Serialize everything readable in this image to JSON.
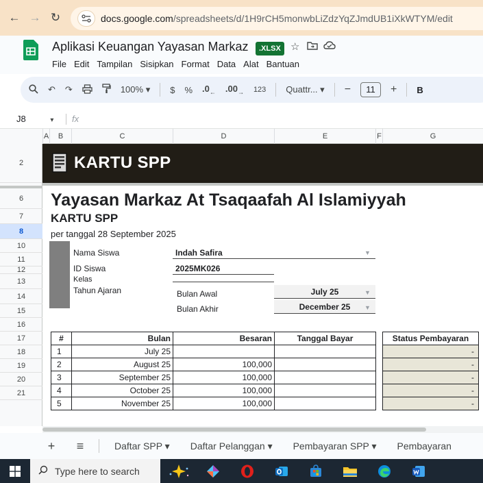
{
  "browser": {
    "back_icon": "arrow-left-icon",
    "forward_icon": "arrow-right-icon",
    "reload_icon": "reload-icon",
    "url_domain": "docs.google.com",
    "url_path": "/spreadsheets/d/1H9rCH5monwbLiZdzYqZJmdUB1iXkWTYM/edit"
  },
  "app": {
    "title": "Aplikasi Keuangan Yayasan Markaz",
    "badge": ".XLSX",
    "menu": [
      "File",
      "Edit",
      "Tampilan",
      "Sisipkan",
      "Format",
      "Data",
      "Alat",
      "Bantuan"
    ]
  },
  "toolbar": {
    "zoom": "100%",
    "currency": "$",
    "percent": "%",
    "dec_decrease": ".0",
    "dec_increase": ".00",
    "number_format": "123",
    "font": "Quattr...",
    "font_size": "11",
    "minus": "−",
    "plus": "+",
    "bold": "B"
  },
  "formula_bar": {
    "cell_ref": "J8",
    "fx": "fx"
  },
  "columns": [
    "A",
    "B",
    "C",
    "D",
    "E",
    "F",
    "G"
  ],
  "rows": [
    "2",
    "6",
    "7",
    "8",
    "10",
    "11",
    "12",
    "13",
    "14",
    "15",
    "16",
    "17",
    "18",
    "19",
    "20",
    "21"
  ],
  "sheet": {
    "banner_title": "KARTU SPP",
    "org_name": "Yayasan Markaz At Tsaqaafah Al Islamiyyah",
    "sub_title": "KARTU SPP",
    "as_of": "per tanggal 28 September 2025",
    "labels": {
      "nama": "Nama Siswa",
      "id": "ID Siswa",
      "kelas": "Kelas",
      "tahun": "Tahun Ajaran",
      "bulan_awal": "Bulan Awal",
      "bulan_akhir": "Bulan Akhir"
    },
    "values": {
      "nama": "Indah Safira",
      "id": "2025MK026",
      "bulan_awal": "July 25",
      "bulan_akhir": "December 25"
    },
    "table_headers": [
      "#",
      "Bulan",
      "Besaran",
      "Tanggal Bayar"
    ],
    "status_header": "Status Pembayaran",
    "table_rows": [
      {
        "no": "1",
        "bulan": "July 25",
        "besaran": "",
        "tanggal": "",
        "status": "-"
      },
      {
        "no": "2",
        "bulan": "August 25",
        "besaran": "100,000",
        "tanggal": "",
        "status": "-"
      },
      {
        "no": "3",
        "bulan": "September 25",
        "besaran": "100,000",
        "tanggal": "",
        "status": "-"
      },
      {
        "no": "4",
        "bulan": "October 25",
        "besaran": "100,000",
        "tanggal": "",
        "status": "-"
      },
      {
        "no": "5",
        "bulan": "November 25",
        "besaran": "100,000",
        "tanggal": "",
        "status": "-"
      }
    ]
  },
  "sheet_tabs": {
    "add": "+",
    "all_sheets": "≡",
    "tabs": [
      "Daftar SPP",
      "Daftar Pelanggan",
      "Pembayaran SPP",
      "Pembayaran"
    ]
  },
  "taskbar": {
    "search_placeholder": "Type here to search"
  }
}
